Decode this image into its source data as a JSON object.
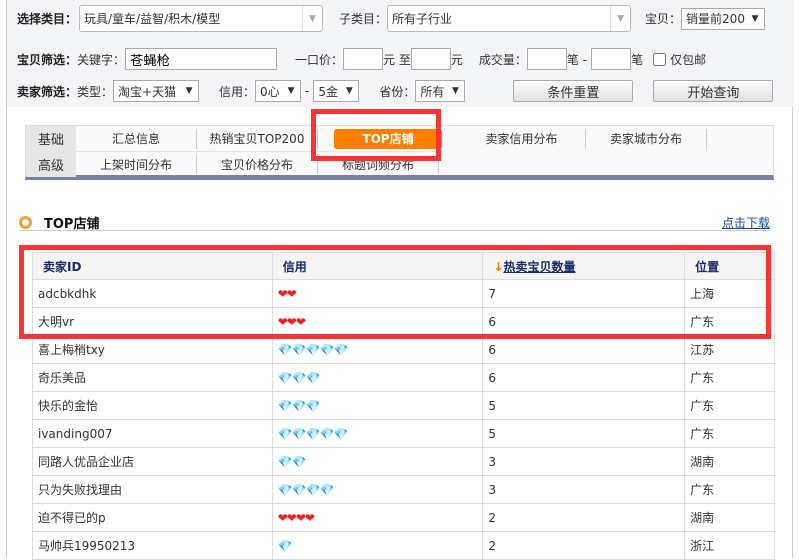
{
  "filter": {
    "category_label": "选择类目：",
    "category_value": "玩具/童车/益智/积木/模型",
    "subcategory_label": "子类目：",
    "subcategory_value": "所有子行业",
    "item_label": "宝贝：",
    "item_value": "销量前200",
    "item_filter_label": "宝贝筛选：",
    "keyword_label": "关键字：",
    "keyword_value": "苍蝇枪",
    "price_label": "一口价：",
    "price_from": "",
    "price_unit1": "元 至",
    "price_to": "",
    "price_unit2": "元",
    "sales_label": "成交量：",
    "sales_from": "",
    "sales_unit1": "笔 -",
    "sales_to": "",
    "sales_unit2": "笔",
    "free_ship_label": "仅包邮",
    "free_ship_checked": false,
    "seller_filter_label": "卖家筛选：",
    "type_label": "类型：",
    "type_value": "淘宝+天猫",
    "credit_label": "信用：",
    "credit_from": "0心",
    "credit_sep": "-",
    "credit_to": "5金",
    "province_label": "省份：",
    "province_value": "所有",
    "reset_label": "条件重置",
    "query_label": "开始查询"
  },
  "tabs": {
    "basic_label": "基础",
    "advanced_label": "高级",
    "basic": [
      "汇总信息",
      "热销宝贝TOP200",
      "TOP店铺",
      "卖家信用分布",
      "卖家城市分布"
    ],
    "advanced": [
      "上架时间分布",
      "宝贝价格分布",
      "标题词频分布"
    ],
    "active": "TOP店铺"
  },
  "section": {
    "title": "TOP店铺",
    "download": "点击下载"
  },
  "table": {
    "headers": [
      "卖家ID",
      "信用",
      "热卖宝贝数量",
      "位置"
    ],
    "sort_arrow": "↓",
    "rows": [
      {
        "id": "adcbkdhk",
        "credit": "❤❤",
        "type": "heart",
        "count": "7",
        "loc": "上海"
      },
      {
        "id": "大明vr",
        "credit": "❤❤❤",
        "type": "heart",
        "count": "6",
        "loc": "广东"
      },
      {
        "id": "喜上梅梢txy",
        "credit": "💎💎💎💎💎",
        "type": "diamond",
        "count": "6",
        "loc": "江苏"
      },
      {
        "id": "奇乐美品",
        "credit": "💎💎💎",
        "type": "diamond",
        "count": "6",
        "loc": "广东"
      },
      {
        "id": "快乐的金怡",
        "credit": "💎💎💎",
        "type": "diamond",
        "count": "5",
        "loc": "广东"
      },
      {
        "id": "ivanding007",
        "credit": "💎💎💎💎💎",
        "type": "diamond",
        "count": "5",
        "loc": "广东"
      },
      {
        "id": "同路人优品企业店",
        "credit": "💎💎",
        "type": "diamond",
        "count": "3",
        "loc": "湖南"
      },
      {
        "id": "只为失败找理由",
        "credit": "💎💎💎💎",
        "type": "diamond",
        "count": "3",
        "loc": "广东"
      },
      {
        "id": "迫不得已的p",
        "credit": "❤❤❤❤",
        "type": "heart",
        "count": "2",
        "loc": "湖南"
      },
      {
        "id": "马帅兵19950213",
        "credit": "💎",
        "type": "diamond",
        "count": "2",
        "loc": "浙江"
      }
    ]
  },
  "colors": {
    "accent": "#ff7f00",
    "highlight": "#ff3333",
    "tab_bar": "#7a80a8"
  }
}
